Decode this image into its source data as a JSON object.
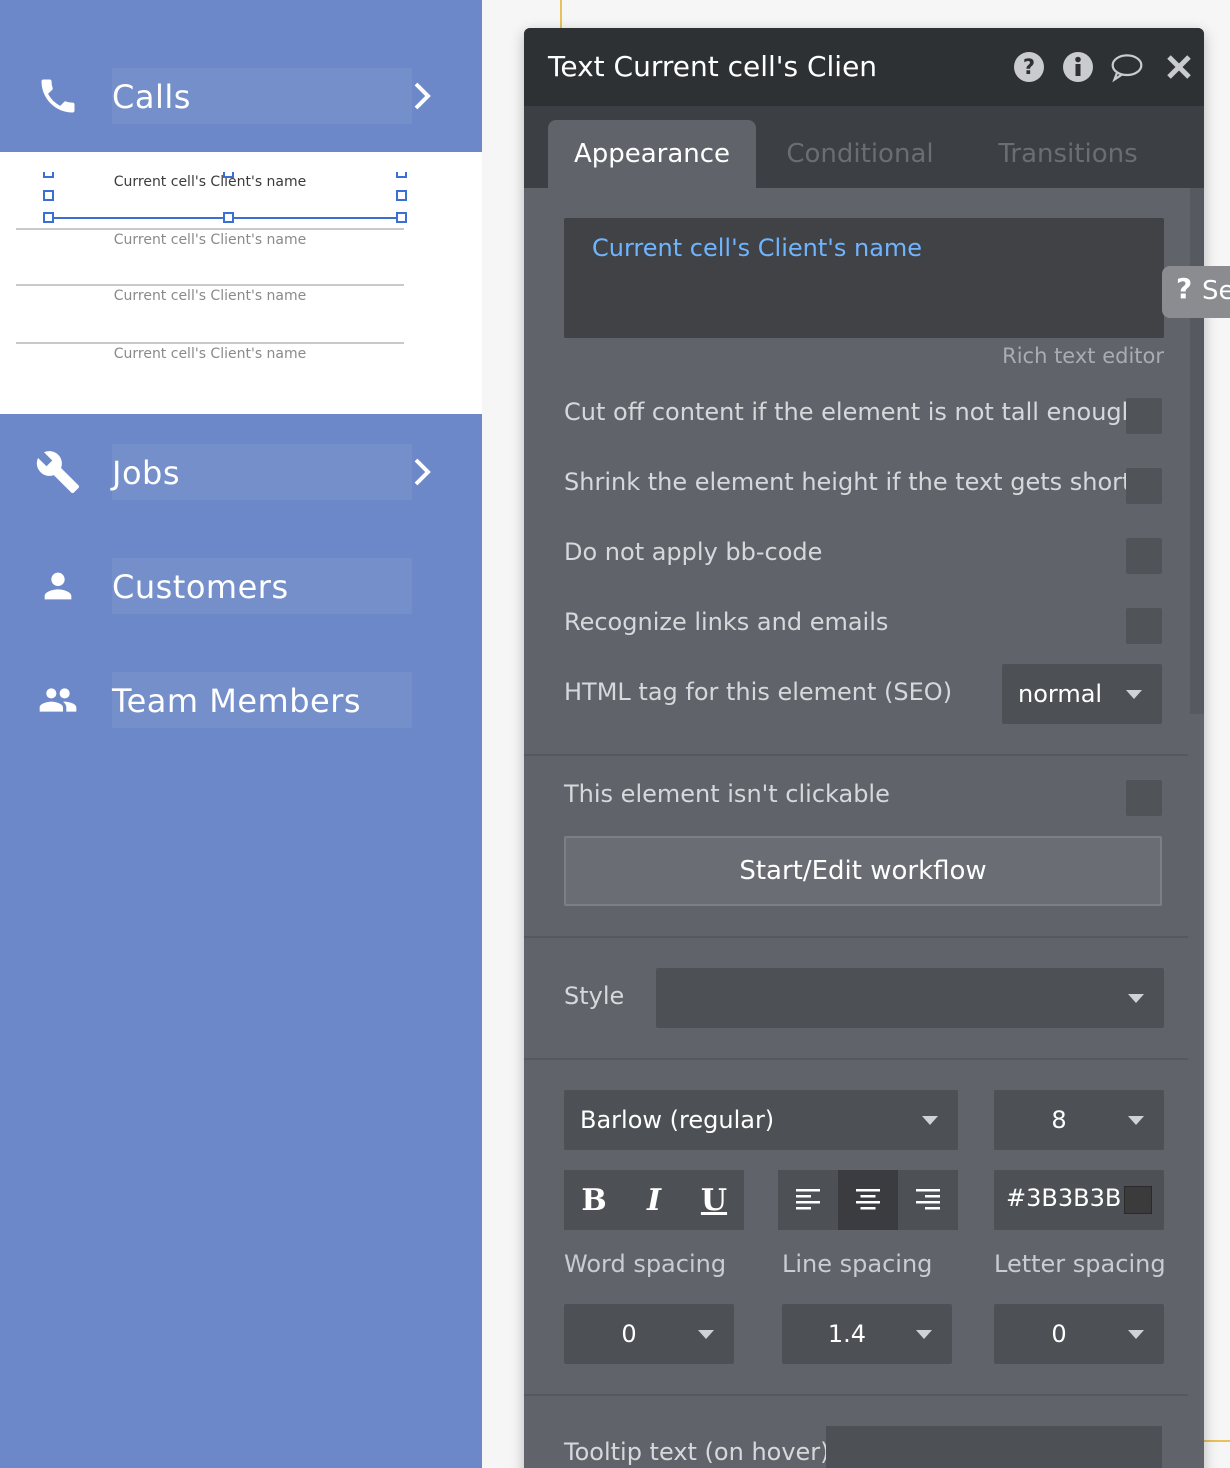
{
  "sidebar": {
    "items": [
      {
        "label": "Calls",
        "icon": "phone-icon"
      },
      {
        "label": "Jobs",
        "icon": "wrench-icon"
      },
      {
        "label": "Customers",
        "icon": "person-icon"
      },
      {
        "label": "Team Members",
        "icon": "group-icon"
      }
    ],
    "repeating_group": {
      "cells": [
        "Current cell's Client's name",
        "Current cell's Client's name",
        "Current cell's Client's name",
        "Current cell's Client's name"
      ]
    }
  },
  "panel": {
    "title": "Text Current cell's Clien",
    "header_icons": [
      "help-circle-icon",
      "info-icon",
      "comment-icon",
      "close-icon"
    ],
    "tabs": [
      {
        "label": "Appearance",
        "active": true
      },
      {
        "label": "Conditional",
        "active": false
      },
      {
        "label": "Transitions",
        "active": false
      }
    ],
    "text_content": "Current cell's Client's name",
    "rich_text_editor_label": "Rich text editor",
    "options": [
      {
        "label": "Cut off content if the element is not tall enough",
        "checked": false
      },
      {
        "label": "Shrink the element height if the text gets shorter",
        "checked": false
      },
      {
        "label": "Do not apply bb-code",
        "checked": false
      },
      {
        "label": "Recognize links and emails",
        "checked": false
      }
    ],
    "html_tag": {
      "label": "HTML tag for this element (SEO)",
      "value": "normal"
    },
    "not_clickable": {
      "label": "This element isn't clickable",
      "checked": false
    },
    "workflow_button": "Start/Edit workflow",
    "style": {
      "label": "Style",
      "value": ""
    },
    "font": {
      "family": "Barlow (regular)",
      "size": "8"
    },
    "format_buttons": {
      "bold": "B",
      "italic": "I",
      "underline": "U"
    },
    "alignment": {
      "active": "center"
    },
    "font_color": {
      "hex": "#3B3B3B"
    },
    "spacing": [
      {
        "label": "Word spacing",
        "value": "0"
      },
      {
        "label": "Line spacing",
        "value": "1.4"
      },
      {
        "label": "Letter spacing",
        "value": "0"
      }
    ],
    "tooltip": {
      "label": "Tooltip text (on hover)",
      "value": ""
    }
  },
  "help_tab": {
    "label": "Se"
  },
  "colors": {
    "sidebar_bg": "#6D88C8",
    "panel_bg": "#60646A",
    "panel_header": "#2E3134",
    "link_blue": "#6FB4FF",
    "selection_blue": "#3B6FD4"
  }
}
